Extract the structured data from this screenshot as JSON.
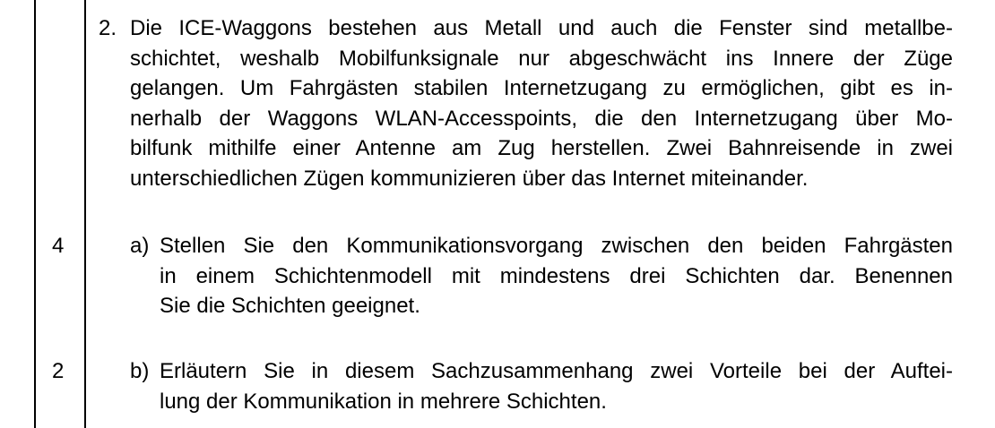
{
  "item": {
    "number": "2.",
    "intro_lines": [
      "Die ICE-Waggons bestehen aus Metall und auch die Fenster sind metallbe-",
      "schichtet, weshalb Mobilfunksignale nur abgeschwächt ins Innere der Züge",
      "gelangen. Um Fahrgästen stabilen Internetzugang zu ermöglichen, gibt es in-",
      "nerhalb der Waggons WLAN-Accesspoints, die den Internetzugang über Mo-",
      "bilfunk mithilfe einer Antenne am Zug herstellen. Zwei Bahnreisende in zwei",
      "unterschiedlichen Zügen kommunizieren über das Internet miteinander."
    ]
  },
  "tasks": [
    {
      "points": "4",
      "marker": "a)",
      "lines": [
        "Stellen Sie den Kommunikationsvorgang zwischen den beiden Fahrgästen",
        "in einem Schichtenmodell mit mindestens drei Schichten dar. Benennen",
        "Sie die Schichten geeignet."
      ]
    },
    {
      "points": "2",
      "marker": "b)",
      "lines": [
        "Erläutern Sie in diesem Sachzusammenhang zwei Vorteile bei der Auftei-",
        "lung der Kommunikation in mehrere Schichten."
      ]
    }
  ]
}
